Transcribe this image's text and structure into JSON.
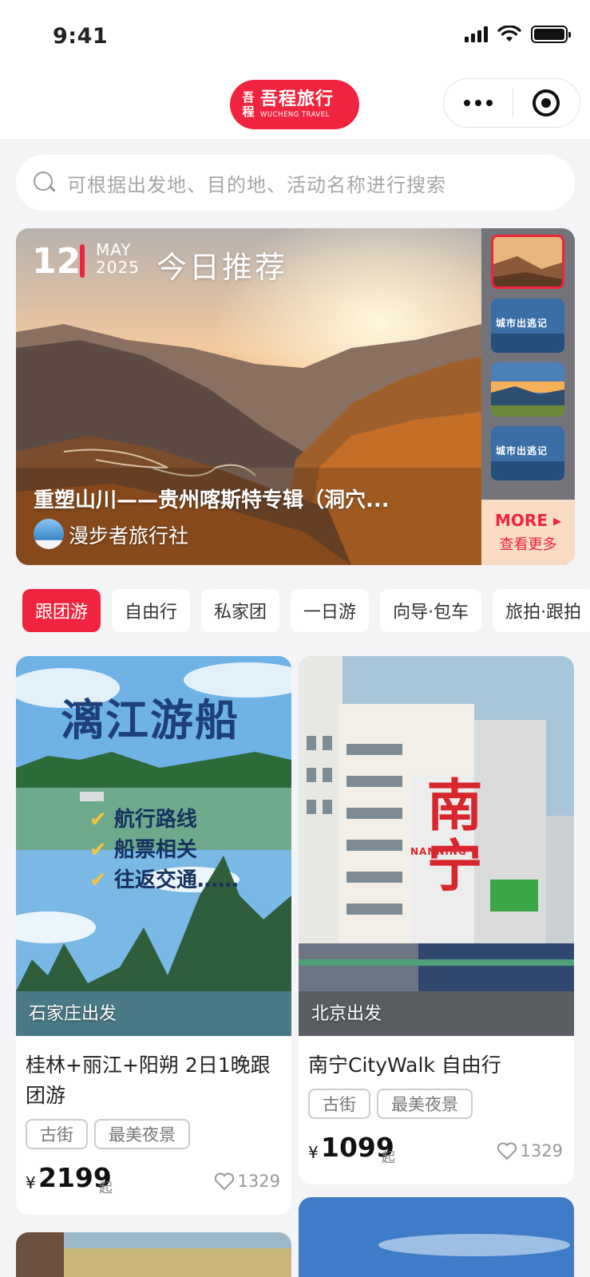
{
  "status_bar": {
    "time": "9:41"
  },
  "nav": {
    "logo_mark": "吾程",
    "logo_name": "吾程旅行",
    "logo_sub": "WUCHENG TRAVEL"
  },
  "search": {
    "placeholder": "可根据出发地、目的地、活动名称进行搜索"
  },
  "banner": {
    "day": "12",
    "month": "MAY",
    "year": "2025",
    "tag": "今日推荐",
    "title": "重塑山川——贵州喀斯特专辑（洞穴...",
    "agency": "漫步者旅行社",
    "thumb_texts": [
      "城市出逃记",
      "城市出逃记"
    ],
    "more_label": "MORE ▸",
    "more_sub": "查看更多"
  },
  "categories": [
    "跟团游",
    "自由行",
    "私家团",
    "一日游",
    "向导·包车",
    "旅拍·跟拍"
  ],
  "cards": [
    {
      "poster_title": "漓江游船",
      "poster_lines": [
        "航行路线",
        "船票相关",
        "往返交通……"
      ],
      "depart": "石家庄出发",
      "title": "桂林+丽江+阳朔 2日1晚跟团游",
      "tags": [
        "古街",
        "最美夜景"
      ],
      "currency": "¥",
      "price": "2199",
      "suffix": "起",
      "likes": "1329"
    },
    {
      "poster_title": "南宁",
      "poster_sub": "NANNING",
      "depart": "北京出发",
      "title": "南宁CityWalk  自由行",
      "tags": [
        "古街",
        "最美夜景"
      ],
      "currency": "¥",
      "price": "1099",
      "suffix": "起",
      "likes": "1329"
    }
  ],
  "colors": {
    "accent": "#f0243e",
    "background": "#f4f4f6"
  }
}
